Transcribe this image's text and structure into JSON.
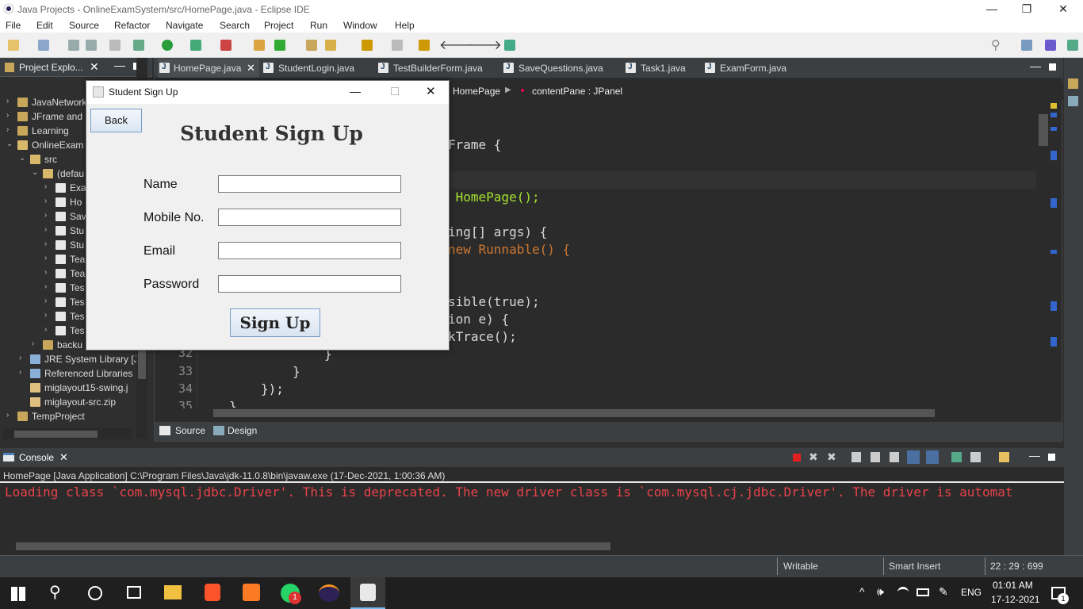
{
  "window": {
    "title": "Java Projects - OnlineExamSystem/src/HomePage.java - Eclipse IDE",
    "controls": {
      "minimize": "—",
      "restore": "❐",
      "close": "✕"
    }
  },
  "menu": [
    "File",
    "Edit",
    "Source",
    "Refactor",
    "Navigate",
    "Search",
    "Project",
    "Run",
    "Window",
    "Help"
  ],
  "explorer": {
    "title": "Project Explo...",
    "items": [
      {
        "label": "JavaNetwork"
      },
      {
        "label": "JFrame and ..."
      },
      {
        "label": "Learning"
      },
      {
        "label": "OnlineExam"
      },
      {
        "label": "src"
      },
      {
        "label": "(defau"
      },
      {
        "label": "Exa"
      },
      {
        "label": "Ho"
      },
      {
        "label": "Sav"
      },
      {
        "label": "Stu"
      },
      {
        "label": "Stu"
      },
      {
        "label": "Tea"
      },
      {
        "label": "Tea"
      },
      {
        "label": "Tes"
      },
      {
        "label": "Tes"
      },
      {
        "label": "Tes"
      },
      {
        "label": "Tes"
      },
      {
        "label": "backu"
      },
      {
        "label": "JRE System Library [J"
      },
      {
        "label": "Referenced Libraries"
      },
      {
        "label": "miglayout15-swing.j"
      },
      {
        "label": "miglayout-src.zip"
      },
      {
        "label": "TempProject"
      }
    ]
  },
  "editor": {
    "tabs": [
      "HomePage.java",
      "StudentLogin.java",
      "TestBuilderForm.java",
      "SaveQuestions.java",
      "Task1.java",
      "ExamForm.java"
    ],
    "breadcrumb": {
      "class": "HomePage",
      "field": "contentPane : JPanel"
    },
    "code_lines": [
      {
        "text": "Frame {"
      },
      {
        "text": " HomePage();"
      },
      {
        "text": "ing[] args) {"
      },
      {
        "text": "new Runnable() {"
      },
      {
        "text": "sible(true);"
      },
      {
        "text": "ion e) {"
      },
      {
        "text": "kTrace();"
      },
      {
        "num": "32",
        "text": "}"
      },
      {
        "num": "33",
        "text": "}"
      },
      {
        "num": "34",
        "text": "});"
      },
      {
        "num": "35",
        "text": "}"
      }
    ],
    "bottom_tabs": [
      "Source",
      "Design"
    ]
  },
  "console": {
    "title": "Console",
    "process": "HomePage [Java Application] C:\\Program Files\\Java\\jdk-11.0.8\\bin\\javaw.exe  (17-Dec-2021, 1:00:36 AM)",
    "output": "Loading class `com.mysql.jdbc.Driver'. This is deprecated. The new driver class is `com.mysql.cj.jdbc.Driver'. The driver is automat"
  },
  "status": {
    "mode": "Writable",
    "insert": "Smart Insert",
    "position": "22 : 29 : 699"
  },
  "taskbar": {
    "lang": "ENG",
    "time": "01:01 AM",
    "date": "17-12-2021",
    "notif_badge": "1",
    "whatsapp_badge": "1"
  },
  "dialog": {
    "title": "Student Sign Up",
    "back_label": "Back",
    "heading": "Student Sign Up",
    "fields": [
      {
        "label": "Name",
        "value": ""
      },
      {
        "label": "Mobile No.",
        "value": ""
      },
      {
        "label": "Email",
        "value": ""
      },
      {
        "label": "Password",
        "value": ""
      }
    ],
    "submit_label": "Sign Up"
  },
  "colors": {
    "error_text": "#e8434a",
    "keyword": "#cc7832",
    "type": "#a6e22e",
    "string_bool": "#f0a030"
  }
}
